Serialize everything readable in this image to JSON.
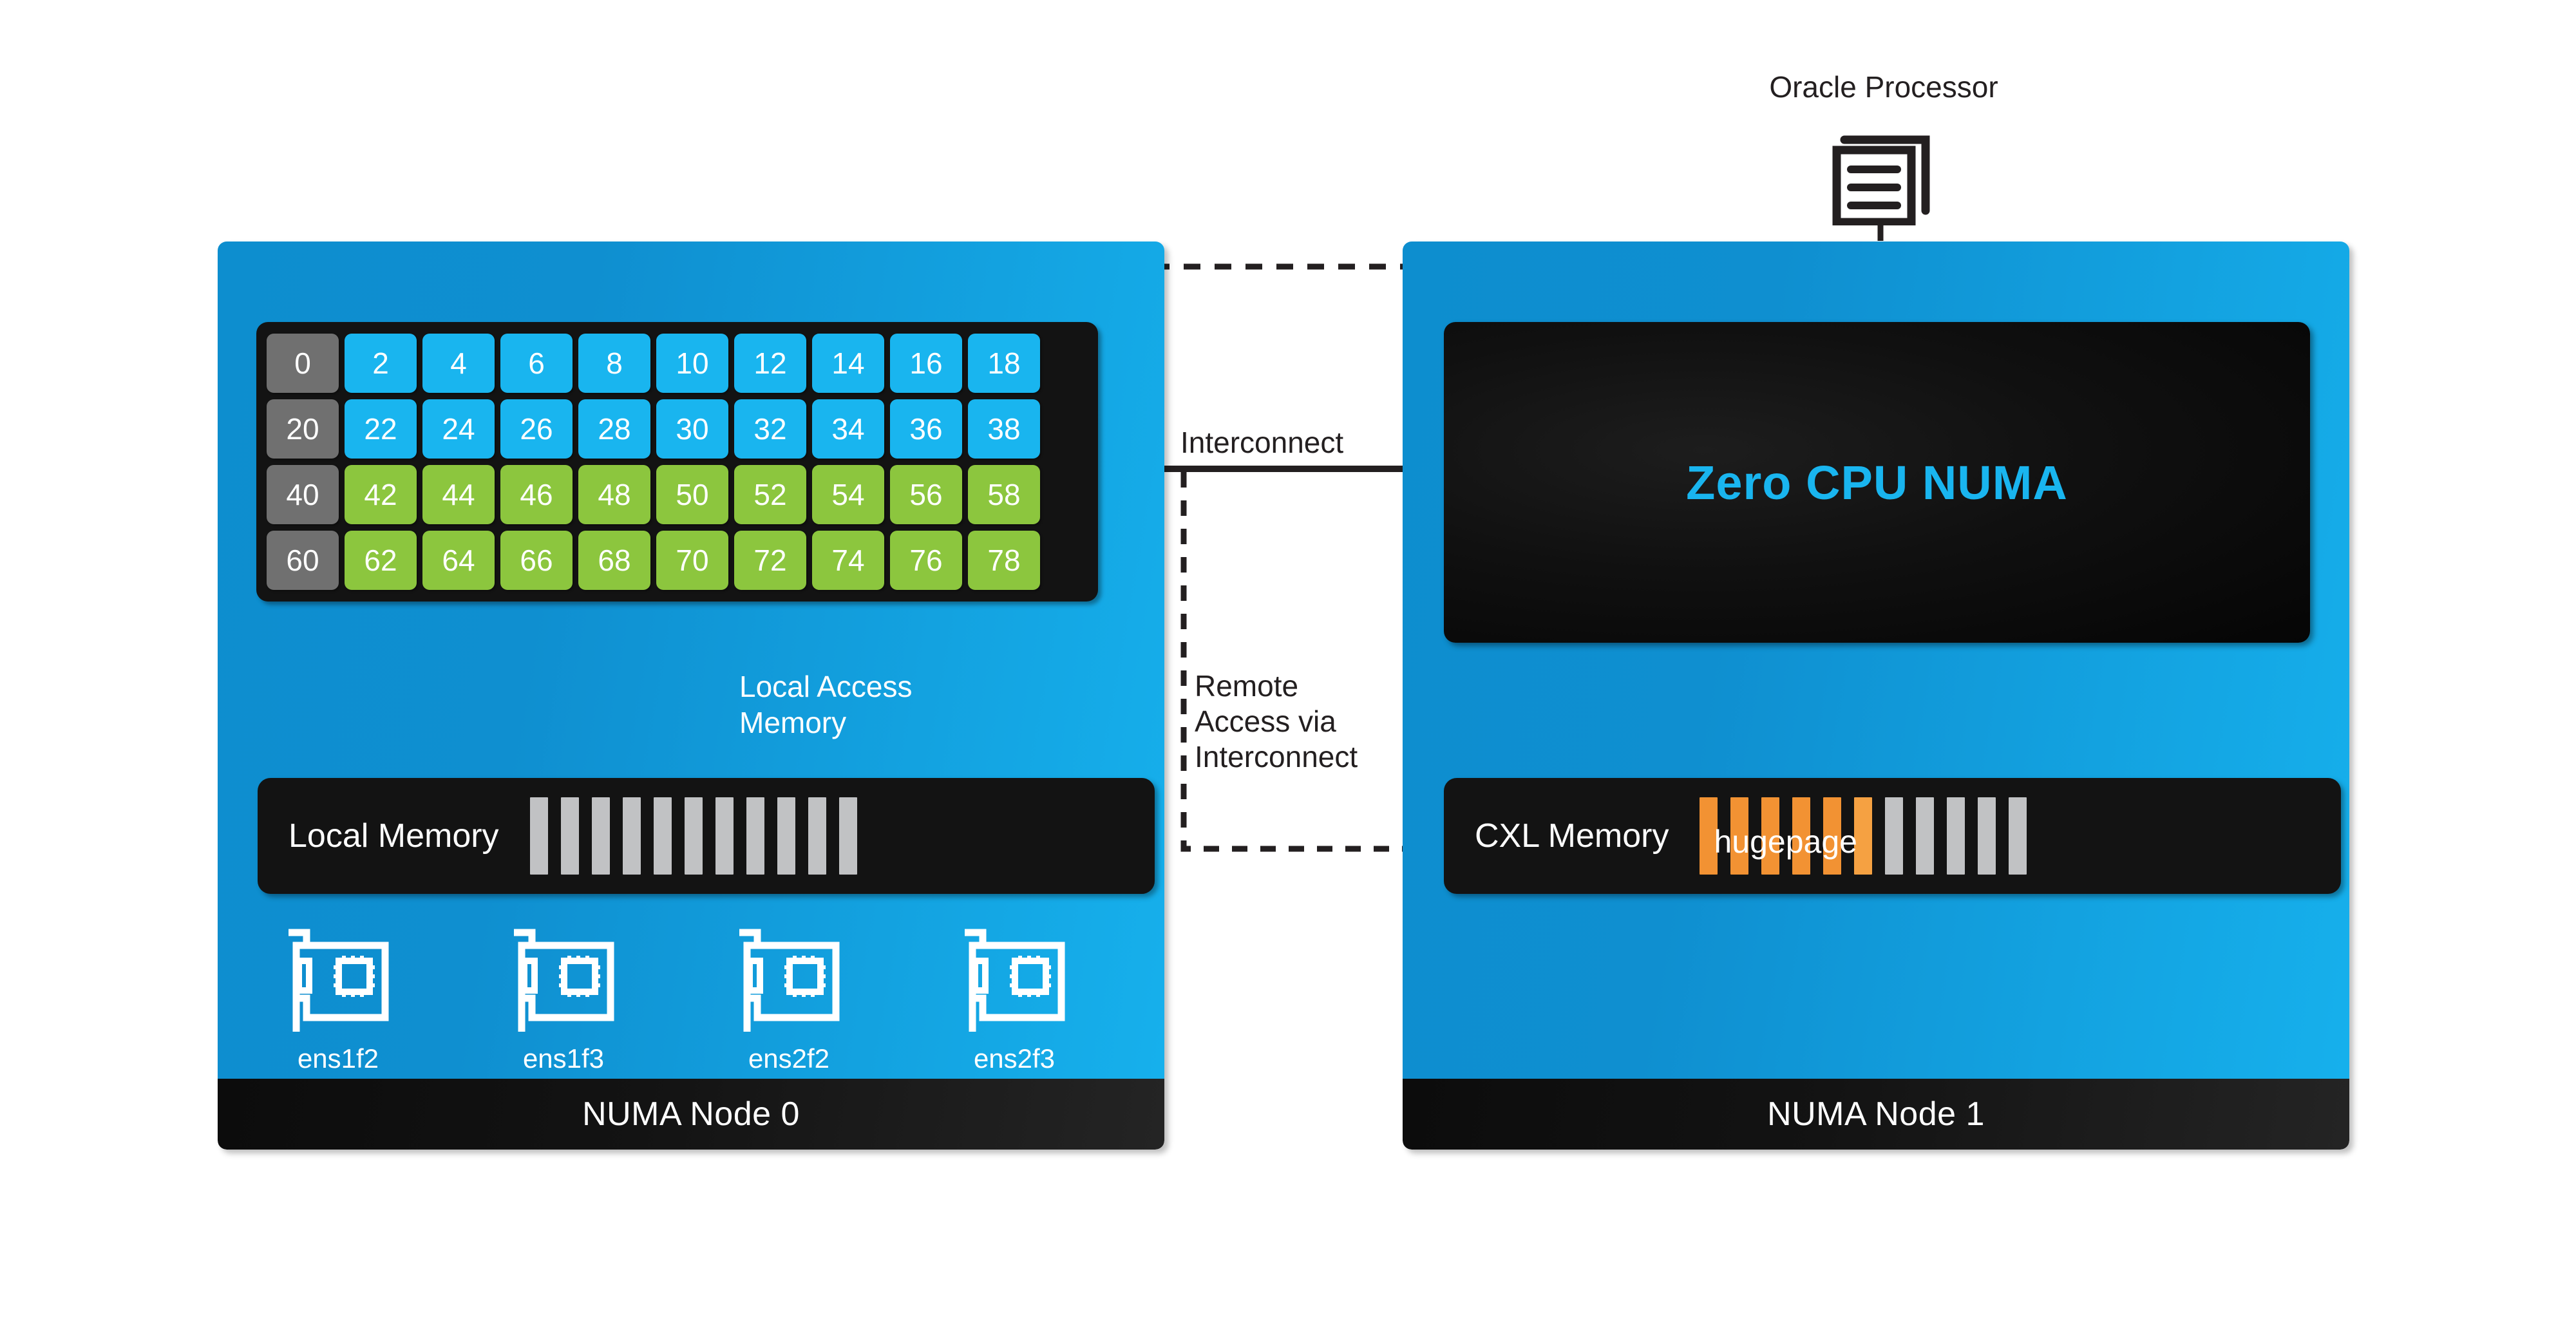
{
  "diagram": {
    "title": "NUMA node topology with CXL memory",
    "colors": {
      "panel_blue": "#0f8fd0",
      "panel_blue_light": "#16b0ec",
      "core_gray": "#707070",
      "core_cyan": "#19b5ef",
      "core_green": "#8cc63e",
      "mem_slot_gray": "#c1c2c4",
      "hugepage_orange": "#f29233",
      "accent_text_blue": "#19b5ef",
      "black": "#131313",
      "white": "#ffffff"
    }
  },
  "oracle": {
    "label": "Oracle Processor",
    "icon": "stacked-documents-icon"
  },
  "node0": {
    "footer_label": "NUMA Node 0",
    "core_grid": {
      "rows": [
        {
          "cells": [
            {
              "value": "0",
              "color": "gray"
            },
            {
              "value": "2",
              "color": "cyan"
            },
            {
              "value": "4",
              "color": "cyan"
            },
            {
              "value": "6",
              "color": "cyan"
            },
            {
              "value": "8",
              "color": "cyan"
            },
            {
              "value": "10",
              "color": "cyan"
            },
            {
              "value": "12",
              "color": "cyan"
            },
            {
              "value": "14",
              "color": "cyan"
            },
            {
              "value": "16",
              "color": "cyan"
            },
            {
              "value": "18",
              "color": "cyan"
            }
          ]
        },
        {
          "cells": [
            {
              "value": "20",
              "color": "gray"
            },
            {
              "value": "22",
              "color": "cyan"
            },
            {
              "value": "24",
              "color": "cyan"
            },
            {
              "value": "26",
              "color": "cyan"
            },
            {
              "value": "28",
              "color": "cyan"
            },
            {
              "value": "30",
              "color": "cyan"
            },
            {
              "value": "32",
              "color": "cyan"
            },
            {
              "value": "34",
              "color": "cyan"
            },
            {
              "value": "36",
              "color": "cyan"
            },
            {
              "value": "38",
              "color": "cyan"
            }
          ]
        },
        {
          "cells": [
            {
              "value": "40",
              "color": "gray"
            },
            {
              "value": "42",
              "color": "green"
            },
            {
              "value": "44",
              "color": "green"
            },
            {
              "value": "46",
              "color": "green"
            },
            {
              "value": "48",
              "color": "green"
            },
            {
              "value": "50",
              "color": "green"
            },
            {
              "value": "52",
              "color": "green"
            },
            {
              "value": "54",
              "color": "green"
            },
            {
              "value": "56",
              "color": "green"
            },
            {
              "value": "58",
              "color": "green"
            }
          ]
        },
        {
          "cells": [
            {
              "value": "60",
              "color": "gray"
            },
            {
              "value": "62",
              "color": "green"
            },
            {
              "value": "64",
              "color": "green"
            },
            {
              "value": "66",
              "color": "green"
            },
            {
              "value": "68",
              "color": "green"
            },
            {
              "value": "70",
              "color": "green"
            },
            {
              "value": "72",
              "color": "green"
            },
            {
              "value": "74",
              "color": "green"
            },
            {
              "value": "76",
              "color": "green"
            },
            {
              "value": "78",
              "color": "green"
            }
          ]
        }
      ]
    },
    "local_memory": {
      "label": "Local Memory",
      "slot_count": 11,
      "slots": [
        "gray",
        "gray",
        "gray",
        "gray",
        "gray",
        "gray",
        "gray",
        "gray",
        "gray",
        "gray",
        "gray"
      ]
    },
    "nics": [
      {
        "label": "ens1f2",
        "icon": "network-card-icon"
      },
      {
        "label": "ens1f3",
        "icon": "network-card-icon"
      },
      {
        "label": "ens2f2",
        "icon": "network-card-icon"
      },
      {
        "label": "ens2f3",
        "icon": "network-card-icon"
      }
    ],
    "local_access_label": "Local Access\nMemory",
    "local_access_label_line1": "Local Access",
    "local_access_label_line2": "Memory"
  },
  "node1": {
    "footer_label": "NUMA Node 1",
    "zero_cpu_label": "Zero CPU NUMA",
    "cxl_memory": {
      "label": "CXL Memory",
      "hugepage_label": "hugepage",
      "slot_count": 11,
      "slots": [
        "orange",
        "orange",
        "orange",
        "orange",
        "orange",
        "orange",
        "gray",
        "gray",
        "gray",
        "gray",
        "gray"
      ]
    }
  },
  "annotations": {
    "interconnect": "Interconnect",
    "remote_access_line1": "Remote",
    "remote_access_line2": "Access via",
    "remote_access_line3": "Interconnect"
  }
}
